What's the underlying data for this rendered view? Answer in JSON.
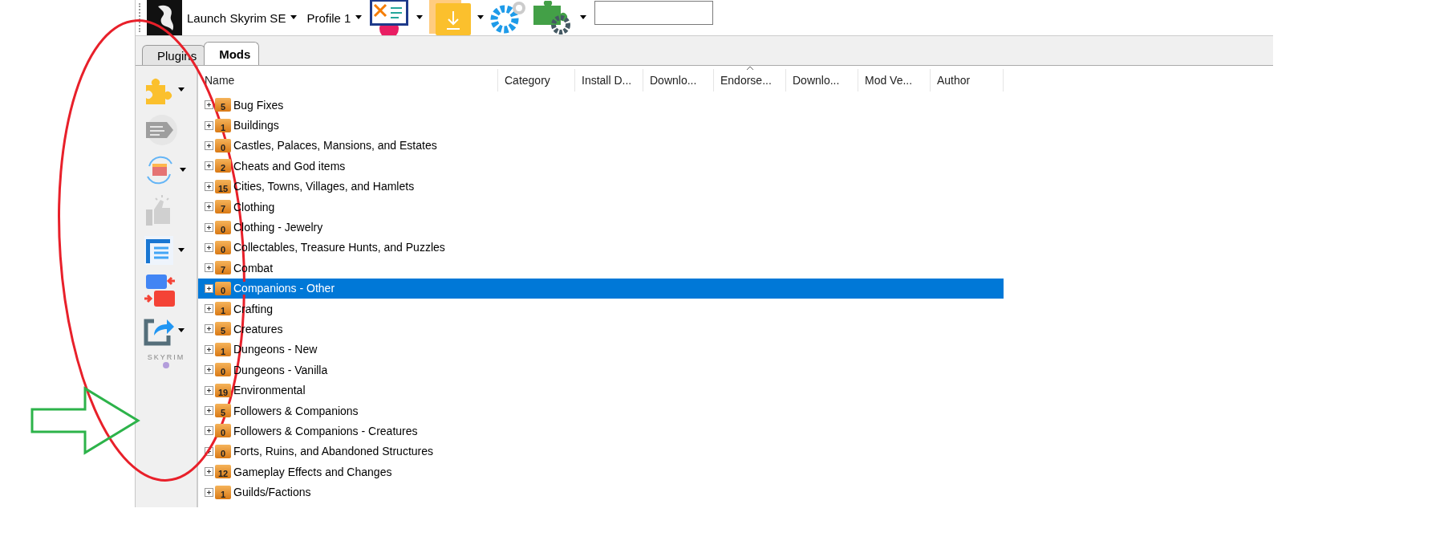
{
  "toolbar": {
    "launch_label": "Launch Skyrim SE",
    "profile_label": "Profile 1"
  },
  "tabs": [
    {
      "label": "Plugins",
      "selected": false
    },
    {
      "label": "Mods",
      "selected": true
    }
  ],
  "side_tools": [
    {
      "kind": "puzzle",
      "dropdown": true
    },
    {
      "kind": "tag",
      "dropdown": false
    },
    {
      "kind": "refresh",
      "dropdown": true
    },
    {
      "kind": "thumb",
      "dropdown": false
    },
    {
      "kind": "list",
      "dropdown": true
    },
    {
      "kind": "swap",
      "dropdown": false
    },
    {
      "kind": "share",
      "dropdown": true
    },
    {
      "kind": "logo",
      "text": "SKYRIM"
    }
  ],
  "table": {
    "columns": [
      {
        "label": "Name",
        "sorted": false
      },
      {
        "label": "Category",
        "sorted": false
      },
      {
        "label": "Install D...",
        "sorted": false
      },
      {
        "label": "Downlo...",
        "sorted": false
      },
      {
        "label": "Endorse...",
        "sorted": true
      },
      {
        "label": "Downlo...",
        "sorted": false
      },
      {
        "label": "Mod Ve...",
        "sorted": false
      },
      {
        "label": "Author",
        "sorted": false
      }
    ],
    "rows": [
      {
        "count": "5",
        "name": "Bug Fixes",
        "selected": false
      },
      {
        "count": "1",
        "name": "Buildings",
        "selected": false
      },
      {
        "count": "0",
        "name": "Castles, Palaces, Mansions, and Estates",
        "selected": false
      },
      {
        "count": "2",
        "name": "Cheats and God items",
        "selected": false
      },
      {
        "count": "15",
        "name": "Cities, Towns, Villages, and Hamlets",
        "selected": false
      },
      {
        "count": "7",
        "name": "Clothing",
        "selected": false
      },
      {
        "count": "0",
        "name": "Clothing - Jewelry",
        "selected": false
      },
      {
        "count": "0",
        "name": "Collectables, Treasure Hunts, and Puzzles",
        "selected": false
      },
      {
        "count": "7",
        "name": "Combat",
        "selected": false
      },
      {
        "count": "0",
        "name": "Companions - Other",
        "selected": true
      },
      {
        "count": "1",
        "name": "Crafting",
        "selected": false
      },
      {
        "count": "5",
        "name": "Creatures",
        "selected": false
      },
      {
        "count": "1",
        "name": "Dungeons - New",
        "selected": false
      },
      {
        "count": "0",
        "name": "Dungeons - Vanilla",
        "selected": false
      },
      {
        "count": "19",
        "name": "Environmental",
        "selected": false
      },
      {
        "count": "5",
        "name": "Followers & Companions",
        "selected": false
      },
      {
        "count": "0",
        "name": "Followers & Companions - Creatures",
        "selected": false
      },
      {
        "count": "0",
        "name": "Forts, Ruins, and Abandoned Structures",
        "selected": false
      },
      {
        "count": "12",
        "name": "Gameplay Effects and Changes",
        "selected": false
      },
      {
        "count": "1",
        "name": "Guilds/Factions",
        "selected": false
      }
    ]
  }
}
